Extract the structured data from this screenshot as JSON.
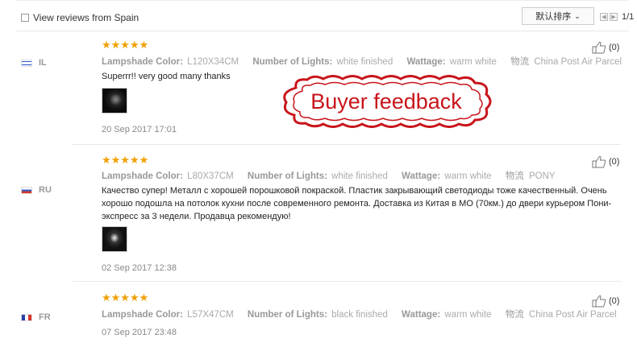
{
  "toolbar": {
    "filter_label": "View reviews from Spain",
    "sort_label": "默认排序",
    "page_indicator": "1/1",
    "prev_icon": "chevron-left-icon",
    "next_icon": "chevron-right-icon"
  },
  "stamp": {
    "text": "Buyer feedback",
    "color": "#c8151b"
  },
  "star_color": "#f0a000",
  "reviews": [
    {
      "country": "IL",
      "stars": "★★★★★",
      "attrs": {
        "k1": "Lampshade Color:",
        "v1": "L120X34CM",
        "k2": "Number of Lights:",
        "v2": "white finished",
        "k3": "Wattage:",
        "v3": "warm white",
        "k4": "物流",
        "v4": "China Post Air Parcel"
      },
      "text": "Superrr!! very good many thanks",
      "date": "20 Sep 2017 17:01",
      "likes": "(0)"
    },
    {
      "country": "RU",
      "stars": "★★★★★",
      "attrs": {
        "k1": "Lampshade Color:",
        "v1": "L80X37CM",
        "k2": "Number of Lights:",
        "v2": "white finished",
        "k3": "Wattage:",
        "v3": "warm white",
        "k4": "物流",
        "v4": "PONY"
      },
      "text_line1": "Качество супер! Металл с хорошей порошковой покраской. Пластик закрывающий светодиоды тоже качественный. Очень",
      "text_line2": "хорошо подошла на потолок кухни после современного ремонта. Доставка из Китая в МО (70км.) до двери курьером Пони-",
      "text_line3": "экспресс за 3 недели. Продавца рекомендую!",
      "date": "02 Sep 2017 12:38",
      "likes": "(0)"
    },
    {
      "country": "FR",
      "stars": "★★★★★",
      "attrs": {
        "k1": "Lampshade Color:",
        "v1": "L57X47CM",
        "k2": "Number of Lights:",
        "v2": "black finished",
        "k3": "Wattage:",
        "v3": "warm white",
        "k4": "物流",
        "v4": "China Post Air Parcel"
      },
      "date": "07 Sep 2017 23:48",
      "likes": "(0)"
    }
  ]
}
